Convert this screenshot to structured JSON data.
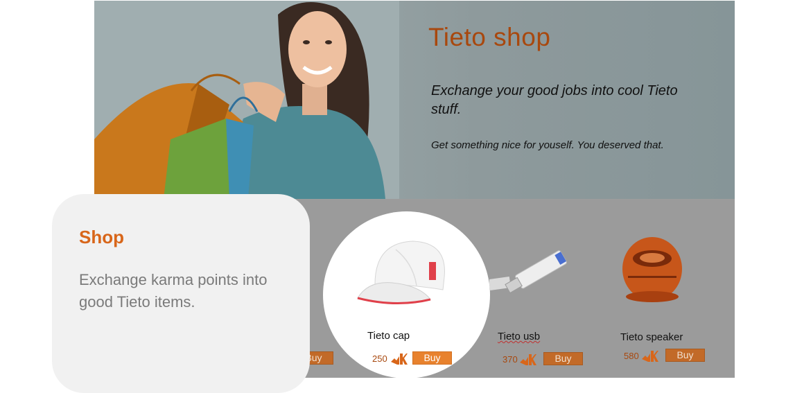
{
  "hero": {
    "title": "Tieto shop",
    "tagline": "Exchange your good jobs into cool Tieto stuff.",
    "subtitle": "Get something nice for youself. You deserved that."
  },
  "products": [
    {
      "name": "Tieto cap",
      "price": "250",
      "buy_label": "Buy",
      "icon": "cap-icon"
    },
    {
      "name": "Tieto usb",
      "price": "370",
      "buy_label": "Buy",
      "icon": "usb-icon"
    },
    {
      "name": "Tieto speaker",
      "price": "580",
      "buy_label": "Buy",
      "icon": "speaker-icon"
    }
  ],
  "hidden_buy_label_fragment": "Buy",
  "callout": {
    "title": "Shop",
    "text": "Exchange karma points into good Tieto items."
  },
  "colors": {
    "accent": "#d8661a",
    "price": "#a8480e",
    "buy_button": "#e8822e"
  }
}
